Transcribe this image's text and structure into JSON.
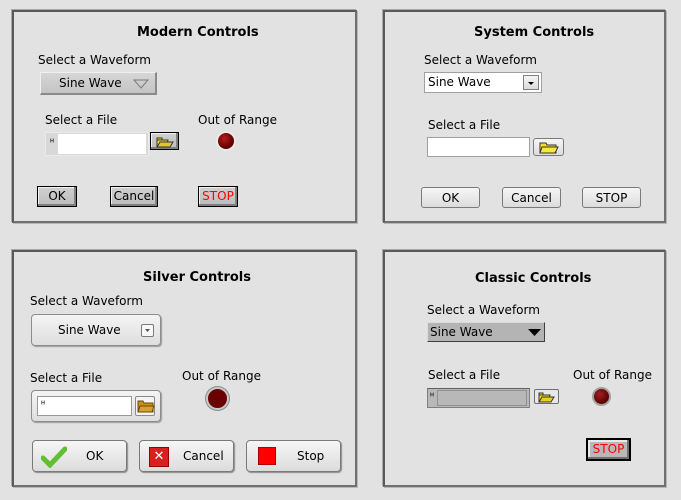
{
  "panels": {
    "modern": {
      "title": "Modern Controls",
      "waveform_label": "Select a Waveform",
      "waveform_value": "Sine Wave",
      "file_label": "Select a File",
      "file_value": "",
      "led_label": "Out of Range",
      "buttons": {
        "ok": "OK",
        "cancel": "Cancel",
        "stop": "STOP"
      }
    },
    "system": {
      "title": "System Controls",
      "waveform_label": "Select a Waveform",
      "waveform_value": "Sine Wave",
      "file_label": "Select a File",
      "file_value": "",
      "buttons": {
        "ok": "OK",
        "cancel": "Cancel",
        "stop": "STOP"
      }
    },
    "silver": {
      "title": "Silver Controls",
      "waveform_label": "Select a Waveform",
      "waveform_value": "Sine Wave",
      "file_label": "Select a File",
      "file_value": "",
      "led_label": "Out of Range",
      "buttons": {
        "ok": "OK",
        "cancel": "Cancel",
        "stop": "Stop"
      }
    },
    "classic": {
      "title": "Classic Controls",
      "waveform_label": "Select a Waveform",
      "waveform_value": "Sine Wave",
      "file_label": "Select a File",
      "file_value": "",
      "led_label": "Out of Range",
      "buttons": {
        "stop": "STOP"
      }
    }
  },
  "colors": {
    "stop_text": "#ff0000",
    "led_off": "#6a0000",
    "folder": "#f0e020"
  }
}
